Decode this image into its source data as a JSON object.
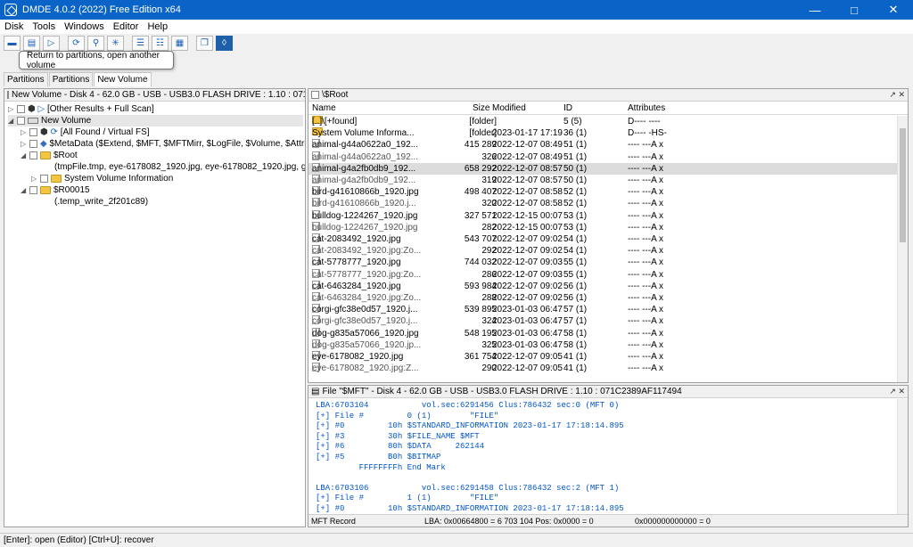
{
  "window": {
    "title": "DMDE 4.0.2 (2022) Free Edition x64"
  },
  "menu": [
    "Disk",
    "Tools",
    "Windows",
    "Editor",
    "Help"
  ],
  "tooltip": "Return to partitions, open another volume",
  "tabs": [
    "Partitions",
    "Partitions",
    "New Volume"
  ],
  "left_pane": {
    "header": "New Volume - Disk 4 - 62.0 GB - USB - USB3.0 FLASH DRIVE : 1.10 : 071C238...",
    "tree": [
      {
        "label": "[Other Results + Full Scan]"
      },
      {
        "label": "New Volume"
      },
      {
        "label": "[All Found / Virtual FS]"
      },
      {
        "label": "$MetaData ($Extend, $MFT, $MFTMirr, $LogFile, $Volume, $AttrDef, $Bitmap, ..."
      },
      {
        "label": "$Root"
      },
      {
        "label": "(tmpFile.tmp, eye-6178082_1920.jpg, eye-6178082_1920.jpg, g...)"
      },
      {
        "label": "System Volume Information"
      },
      {
        "label": "$R00015"
      },
      {
        "label": "(.temp_write_2f201c89)"
      }
    ]
  },
  "right_pane": {
    "header": "\\$Root",
    "columns": {
      "name": "Name",
      "size": "Size",
      "modified": "Modified",
      "id": "ID",
      "attributes": "Attributes"
    },
    "rows": [
      {
        "name": "[..]\\[+found]",
        "size": "[folder]",
        "modified": "",
        "id": "5 (5)",
        "attr": "D---- ----"
      },
      {
        "name": "System Volume Informa...",
        "size": "[folder]",
        "modified": "2023-01-17 17:19",
        "id": "36 (1)",
        "attr": "D---- -HS-"
      },
      {
        "name": "animal-g44a0622a0_192...",
        "size": "415 289",
        "modified": "2022-12-07 08:49",
        "id": "51 (1)",
        "attr": "---- ---A  x"
      },
      {
        "name": "animal-g44a0622a0_192...",
        "size": "326",
        "modified": "2022-12-07 08:49",
        "id": "51 (1)",
        "attr": "---- ---A  x"
      },
      {
        "name": "animal-g4a2fb0db9_192...",
        "size": "658 292",
        "modified": "2022-12-07 08:57",
        "id": "50 (1)",
        "attr": "---- ---A  x"
      },
      {
        "name": "animal-g4a2fb0db9_192...",
        "size": "319",
        "modified": "2022-12-07 08:57",
        "id": "50 (1)",
        "attr": "---- ---A  x"
      },
      {
        "name": "bird-g41610866b_1920.jpg",
        "size": "498 407",
        "modified": "2022-12-07 08:58",
        "id": "52 (1)",
        "attr": "---- ---A  x"
      },
      {
        "name": "bird-g41610866b_1920.j...",
        "size": "320",
        "modified": "2022-12-07 08:58",
        "id": "52 (1)",
        "attr": "---- ---A  x"
      },
      {
        "name": "bulldog-1224267_1920.jpg",
        "size": "327 571",
        "modified": "2022-12-15 00:07",
        "id": "53 (1)",
        "attr": "---- ---A  x"
      },
      {
        "name": "bulldog-1224267_1920.jpg",
        "size": "282",
        "modified": "2022-12-15 00:07",
        "id": "53 (1)",
        "attr": "---- ---A  x"
      },
      {
        "name": "cat-2083492_1920.jpg",
        "size": "543 707",
        "modified": "2022-12-07 09:02",
        "id": "54 (1)",
        "attr": "---- ---A  x"
      },
      {
        "name": "cat-2083492_1920.jpg:Zo...",
        "size": "292",
        "modified": "2022-12-07 09:02",
        "id": "54 (1)",
        "attr": "---- ---A  x"
      },
      {
        "name": "cat-5778777_1920.jpg",
        "size": "744 032",
        "modified": "2022-12-07 09:03",
        "id": "55 (1)",
        "attr": "---- ---A  x"
      },
      {
        "name": "cat-5778777_1920.jpg:Zo...",
        "size": "286",
        "modified": "2022-12-07 09:03",
        "id": "55 (1)",
        "attr": "---- ---A  x"
      },
      {
        "name": "cat-6463284_1920.jpg",
        "size": "593 984",
        "modified": "2022-12-07 09:02",
        "id": "56 (1)",
        "attr": "---- ---A  x"
      },
      {
        "name": "cat-6463284_1920.jpg:Zo...",
        "size": "288",
        "modified": "2022-12-07 09:02",
        "id": "56 (1)",
        "attr": "---- ---A  x"
      },
      {
        "name": "corgi-gfc38e0d57_1920.j...",
        "size": "539 895",
        "modified": "2023-01-03 06:47",
        "id": "57 (1)",
        "attr": "---- ---A  x"
      },
      {
        "name": "corgi-gfc38e0d57_1920.j...",
        "size": "324",
        "modified": "2023-01-03 06:47",
        "id": "57 (1)",
        "attr": "---- ---A  x"
      },
      {
        "name": "dog-g835a57066_1920.jpg",
        "size": "548 195",
        "modified": "2023-01-03 06:47",
        "id": "58 (1)",
        "attr": "---- ---A  x"
      },
      {
        "name": "dog-g835a57066_1920.jp...",
        "size": "325",
        "modified": "2023-01-03 06:47",
        "id": "58 (1)",
        "attr": "---- ---A  x"
      },
      {
        "name": "eye-6178082_1920.jpg",
        "size": "361 754",
        "modified": "2022-12-07 09:05",
        "id": "41 (1)",
        "attr": "---- ---A  x"
      },
      {
        "name": "eye-6178082_1920.jpg:Z...",
        "size": "290",
        "modified": "2022-12-07 09:05",
        "id": "41 (1)",
        "attr": "---- ---A  x"
      }
    ]
  },
  "file_pane": {
    "header": "File \"$MFT\" - Disk 4 - 62.0 GB - USB - USB3.0 FLASH DRIVE : 1.10 : 071C2389AF117494",
    "lines": [
      "LBA:6703104           vol.sec:6291456 Clus:786432 sec:0 (MFT 0)",
      "[+] File #         0 (1)        \"FILE\"",
      "[+] #0         10h $STANDARD_INFORMATION 2023-01-17 17:18:14.895",
      "[+] #3         30h $FILE_NAME $MFT",
      "[+] #6         80h $DATA     262144",
      "[+] #5         B0h $BITMAP",
      "         FFFFFFFFh End Mark",
      "",
      "LBA:6703106           vol.sec:6291458 Clus:786432 sec:2 (MFT 1)",
      "[+] File #         1 (1)        \"FILE\"",
      "[+] #0         10h $STANDARD_INFORMATION 2023-01-17 17:18:14.895",
      "[+] #2         30h $FILE_NAME $MFTMirr",
      "[+] #1         80h $DATA     4096"
    ],
    "status": {
      "mode": "MFT Record",
      "lba": "LBA: 0x00664800 = 6 703 104  Pos: 0x0000 = 0",
      "offset": "0x000000000000 = 0"
    }
  },
  "statusbar": "[Enter]: open (Editor)  [Ctrl+U]: recover"
}
